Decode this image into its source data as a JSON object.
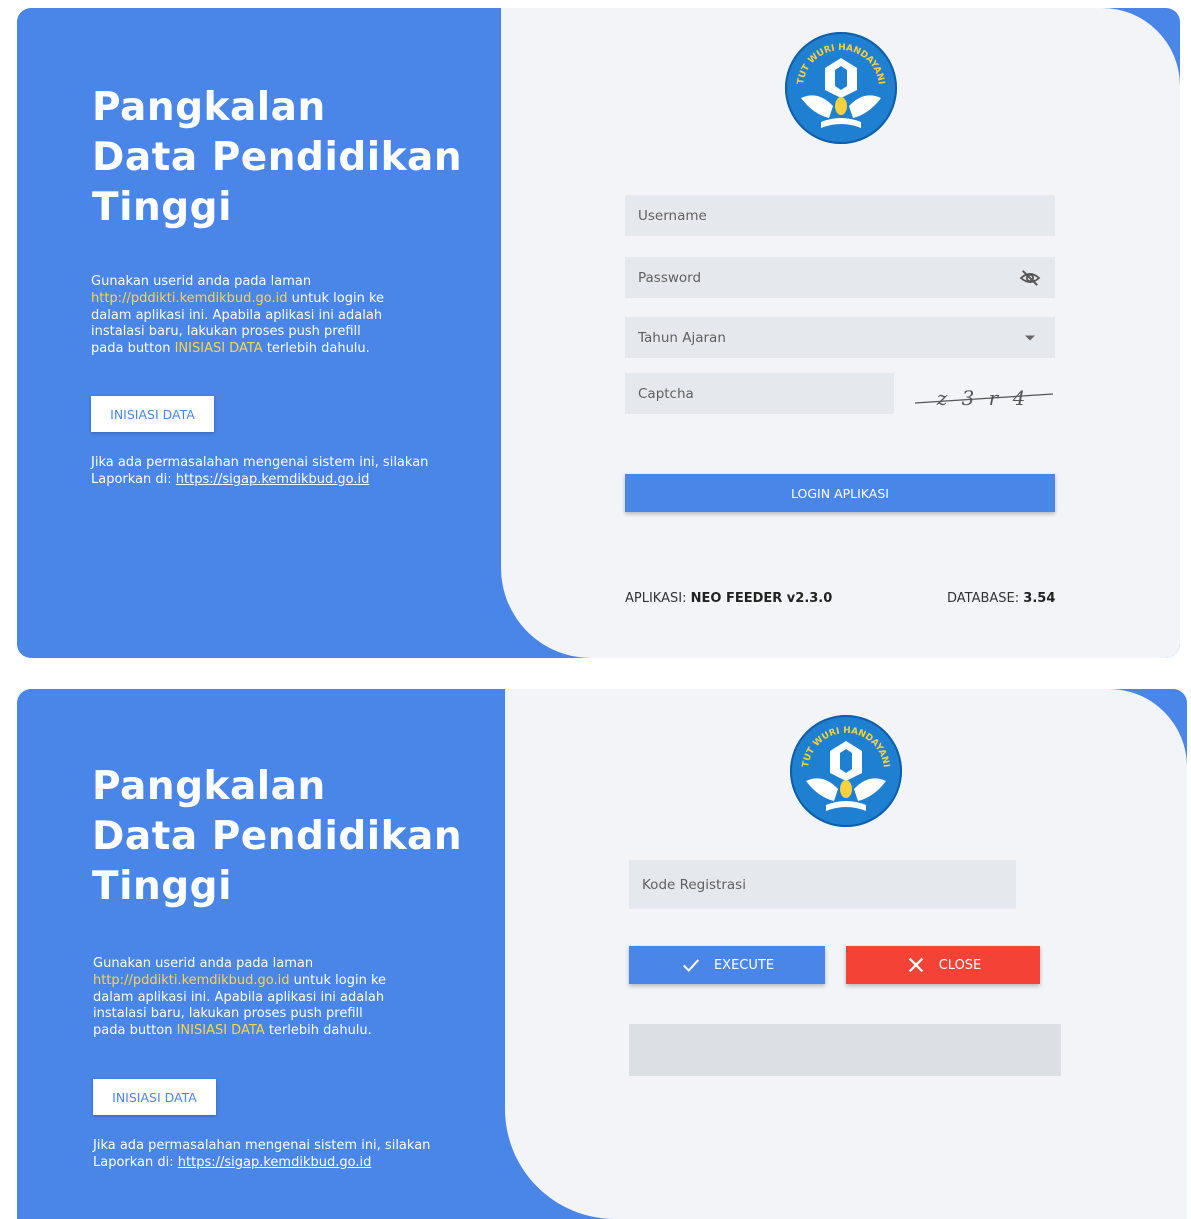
{
  "brand": {
    "title_lines": [
      "Pangkalan",
      "Data Pendidikan",
      "Tinggi"
    ],
    "desc_part1": "Gunakan userid anda pada laman ",
    "desc_link": "http://pddikti.kemdikbud.go.id",
    "desc_part2": " untuk login ke dalam aplikasi ini. Apabila aplikasi ini adalah instalasi baru, lakukan proses push prefill pada button ",
    "desc_highlight": "INISIASI DATA",
    "desc_part3": " terlebih dahulu.",
    "init_button": "INISIASI DATA",
    "report_text": "Jika ada permasalahan mengenai sistem ini, silakan Laporkan di: ",
    "report_link": "https://sigap.kemdikbud.go.id",
    "logo_text": "TUT WURI HANDAYANI"
  },
  "login": {
    "username_placeholder": "Username",
    "password_placeholder": "Password",
    "tahun_ajaran_label": "Tahun Ajaran",
    "captcha_placeholder": "Captcha",
    "captcha_text": "z 3 r 4",
    "login_button": "LOGIN APLIKASI",
    "app_label": "APLIKASI:",
    "app_value": "NEO FEEDER v2.3.0",
    "db_label": "DATABASE:",
    "db_value": "3.54"
  },
  "registration": {
    "kode_placeholder": "Kode Registrasi",
    "execute_button": "EXECUTE",
    "close_button": "CLOSE",
    "output_value": ""
  },
  "colors": {
    "primary": "#4a85e8",
    "danger": "#f44336",
    "highlight": "#ffd54a"
  }
}
